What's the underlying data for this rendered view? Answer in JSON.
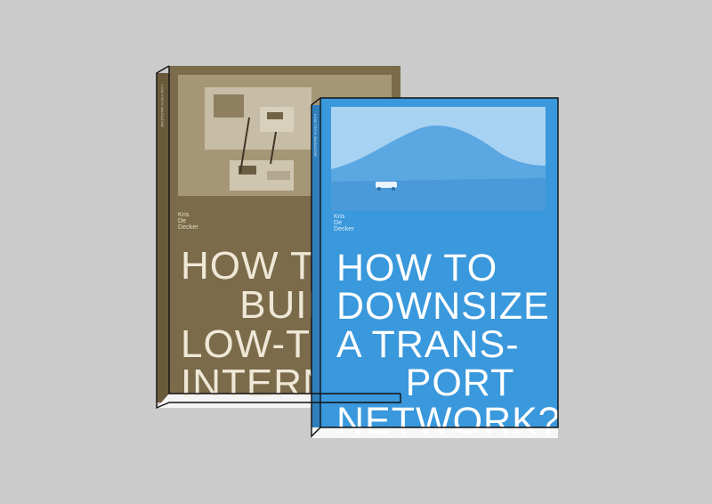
{
  "books": {
    "back": {
      "author": "Kris De Decker",
      "spine_label": "LOW-TECH MAGAZINE",
      "title_lines": [
        "HOW TO",
        "     BUIL",
        "LOW-TE",
        "INTERN"
      ],
      "cover_color": "#7b6b4a"
    },
    "front": {
      "author": "Kris De Decker",
      "spine_label": "LOW-TECH MAGAZINE",
      "title_lines": [
        "HOW TO",
        "DOWNSIZE",
        "A TRANS-",
        "      PORT",
        "NETWORK?"
      ],
      "cover_color": "#3a98dc"
    }
  },
  "background_color": "#cbcbcb"
}
